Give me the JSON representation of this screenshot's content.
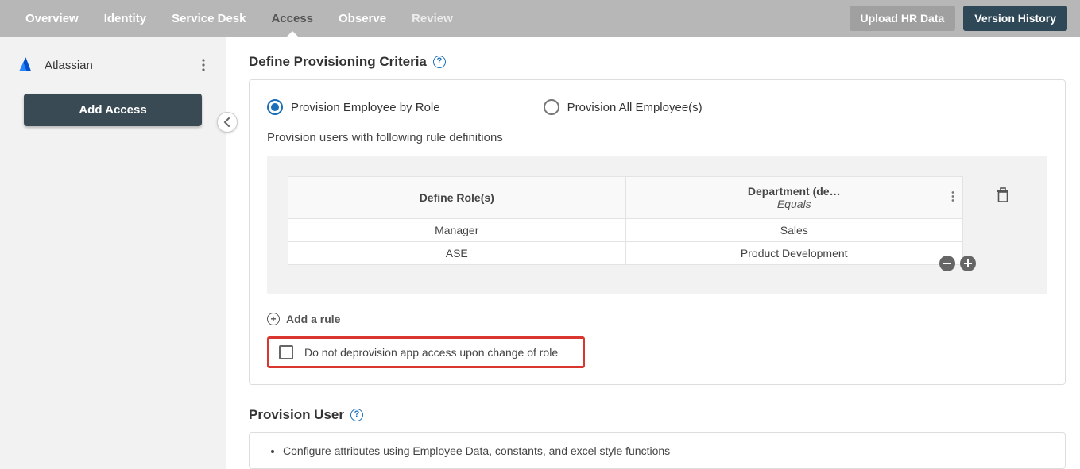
{
  "topbar": {
    "tabs": [
      {
        "label": "Overview"
      },
      {
        "label": "Identity"
      },
      {
        "label": "Service Desk"
      },
      {
        "label": "Access"
      },
      {
        "label": "Observe"
      },
      {
        "label": "Review"
      }
    ],
    "upload_label": "Upload HR Data",
    "version_label": "Version History"
  },
  "sidebar": {
    "app_name": "Atlassian",
    "add_access_label": "Add Access"
  },
  "main": {
    "section1_title": "Define Provisioning Criteria",
    "radio1": "Provision Employee by Role",
    "radio2": "Provision All Employee(s)",
    "subtext": "Provision users with following rule definitions",
    "col1_header": "Define Role(s)",
    "col2_line1": "Department (de…",
    "col2_line2": "Equals",
    "rows": [
      {
        "role": "Manager",
        "dept": "Sales"
      },
      {
        "role": "ASE",
        "dept": "Product Development"
      }
    ],
    "add_rule_label": "Add a rule",
    "checkbox_label": "Do not deprovision app access upon change of role",
    "section2_title": "Provision User",
    "bullet1": "Configure attributes using Employee Data, constants, and excel style functions"
  }
}
